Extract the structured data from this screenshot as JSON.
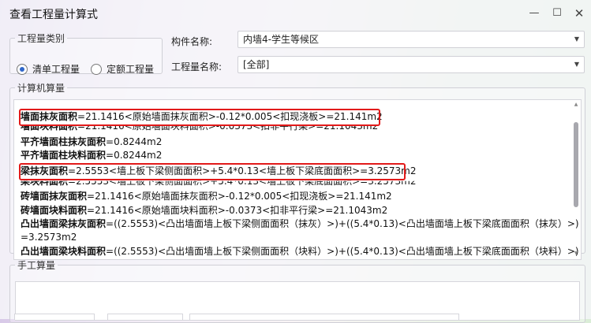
{
  "window": {
    "title": "查看工程量计算式",
    "minimize": "—",
    "maximize": "☐",
    "close": "✕"
  },
  "quantity_type": {
    "legend": "工程量类别",
    "options": [
      {
        "label": "清单工程量",
        "selected": true
      },
      {
        "label": "定额工程量",
        "selected": false
      }
    ]
  },
  "component": {
    "label": "构件名称:",
    "value": "内墙4-学生等候区"
  },
  "quantity_name": {
    "label": "工程量名称:",
    "value": "[全部]"
  },
  "calc_section": {
    "legend": "计算机算量",
    "lines": [
      {
        "name": "墙面抹灰面积",
        "expr": "=21.1416<原始墙面抹灰面积>-0.12*0.005<扣现浇板>=21.141m2",
        "highlight": true
      },
      {
        "name": "墙面块料面积",
        "expr": "=21.1416<原始墙面块料面积>-0.0373<扣非平行梁>=21.1043m2",
        "covered": true
      },
      {
        "name": "平齐墙面柱抹灰面积",
        "expr": "=0.8244m2"
      },
      {
        "name": "平齐墙面柱块料面积",
        "expr": "=0.8244m2"
      },
      {
        "name": "梁抹灰面积",
        "expr": "=2.5553<墙上板下梁侧面面积>+5.4*0.13<墙上板下梁底面面积>=3.2573m2",
        "highlight": true
      },
      {
        "name": "梁块料面积",
        "expr": "=2.5553<墙上板下梁侧面面积>+5.4*0.13<墙上板下梁底面面积>=3.2573m2",
        "covered": true
      },
      {
        "name": "砖墙面抹灰面积",
        "expr": "=21.1416<原始墙面抹灰面积>-0.12*0.005<扣现浇板>=21.141m2"
      },
      {
        "name": "砖墙面块料面积",
        "expr": "=21.1416<原始墙面块料面积>-0.0373<扣非平行梁>=21.1043m2"
      },
      {
        "name": "凸出墙面梁抹灰面积",
        "expr": "=((2.5553)<凸出墙面墙上板下梁侧面面积（抹灰）>)+((5.4*0.13)<凸出墙面墙上板下梁底面面积（抹灰）>)"
      },
      {
        "name": "",
        "expr": "=3.2573m2"
      },
      {
        "name": "凸出墙面梁块料面积",
        "expr": "=((2.5553)<凸出墙面墙上板下梁侧面面积（块料）>)+((5.4*0.13)<凸出墙面墙上板下梁底面面积（块料）>)"
      }
    ]
  },
  "manual_section": {
    "legend": "手工算量"
  },
  "colors": {
    "highlight_border": "#e21a1a",
    "radio_accent": "#2f66c9"
  }
}
